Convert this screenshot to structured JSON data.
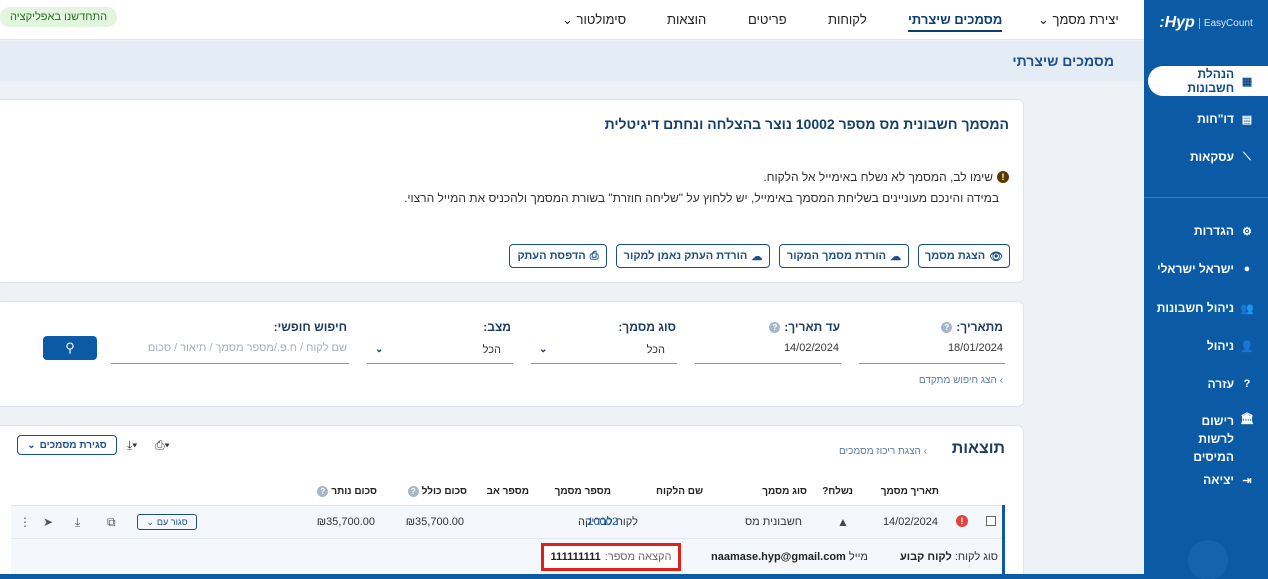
{
  "sidebar": {
    "logo_brand": ":Hyp",
    "logo_product": "EasyCount",
    "items": [
      {
        "label": "הנהלת חשבונות",
        "icon": "calculator-icon"
      },
      {
        "label": "דו\"חות",
        "icon": "chart-bar-icon"
      },
      {
        "label": "עסקאות",
        "icon": "chart-line-icon"
      },
      {
        "label": "הגדרות",
        "icon": "gear-icon"
      },
      {
        "label": "ישראל ישראלי",
        "icon": "user-circle-icon"
      },
      {
        "label": "ניהול חשבונות",
        "icon": "users-icon"
      },
      {
        "label": "ניהול",
        "icon": "user-icon"
      },
      {
        "label": "עזרה",
        "icon": "question-icon"
      },
      {
        "label": "רישום לרשות המיסים",
        "icon": "bank-icon"
      },
      {
        "label": "יציאה",
        "icon": "logout-icon"
      }
    ]
  },
  "topnav": {
    "items": [
      "יצירת מסמך",
      "מסמכים שיצרתי",
      "לקוחות",
      "פריטים",
      "הוצאות",
      "סימולטור"
    ],
    "active": "מסמכים שיצרתי",
    "new_app": "התחדשנו באפליקציה"
  },
  "page": {
    "title": "מסמכים שיצרתי"
  },
  "notice": {
    "headline": "המסמך חשבונית מס מספר 10002 נוצר בהצלחה ונחתם דיגיטלית",
    "warning_line1": "שימו לב, המסמך לא נשלח באימייל אל הלקוח.",
    "warning_line2": "במידה והינכם מעוניינים בשליחת המסמך באימייל, יש ללחוץ על \"שליחה חוזרת\" בשורת המסמך ולהכניס את המייל הרצוי.",
    "buttons": {
      "show_doc": "הצגת מסמך",
      "download_original": "הורדת מסמך המקור",
      "download_copy": "הורדת העתק נאמן למקור",
      "print_copy": "הדפסת העתק"
    }
  },
  "search": {
    "from_label": "מתאריך:",
    "from_value": "18/01/2024",
    "to_label": "עד תאריך:",
    "to_value": "14/02/2024",
    "doc_type_label": "סוג מסמך:",
    "doc_type_value": "הכל",
    "status_label": "מצב:",
    "status_value": "הכל",
    "free_label": "חיפוש חופשי:",
    "free_placeholder": "שם לקוח / ח.פ./מספר מסמך / תיאור / סכום",
    "advanced": "הצג חיפוש מתקדם"
  },
  "results": {
    "title": "תוצאות",
    "summary_link": "הצגת ריכוז מסמכים",
    "close_docs": "סגירת מסמכים",
    "columns": {
      "date": "תאריך מסמך",
      "sent": "נשלח?",
      "type": "סוג מסמך",
      "customer": "שם הלקוח",
      "doc_no": "מספר מסמך",
      "parent_no": "מספר אב",
      "total": "סכום כולל",
      "remaining": "סכום נותר"
    },
    "row": {
      "date": "14/02/2024",
      "type": "חשבונית מס",
      "customer": "לקוח לבדיקה",
      "doc_no": "10002",
      "total": "₪35,700.00",
      "remaining": "₪35,700.00",
      "sort_btn": "סגור עם"
    },
    "detail": {
      "customer_type_label": "סוג לקוח:",
      "customer_type_value": "לקוח קבוע",
      "email_label": "מייל",
      "email_value": "naamase.hyp@gmail.com",
      "allocation_label": "הקצאה מספר:",
      "allocation_value": "111111111"
    }
  }
}
